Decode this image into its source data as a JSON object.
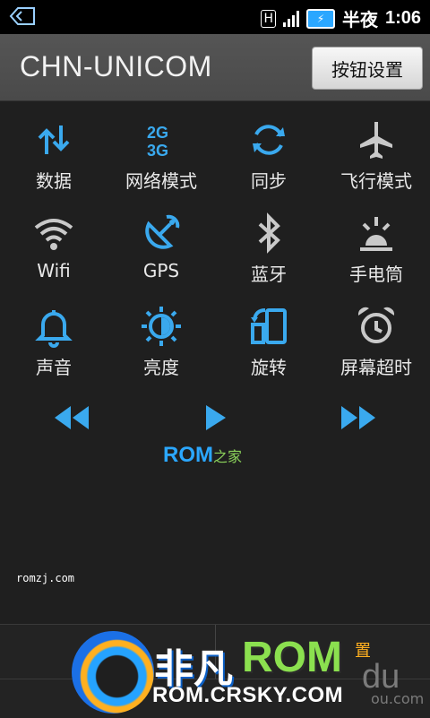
{
  "status_bar": {
    "time": "1:06",
    "period": "半夜",
    "network": "H",
    "back_icon": "back-arrow-icon",
    "battery_icon": "battery-charging-icon",
    "signal_icon": "signal-strength-icon"
  },
  "header": {
    "carrier": "CHN-UNICOM",
    "settings_button": "按钮设置"
  },
  "toggles": [
    {
      "label": "数据",
      "icon": "data-transfer-icon",
      "active": true
    },
    {
      "label": "网络模式",
      "icon": "network-2g3g-icon",
      "active": true
    },
    {
      "label": "同步",
      "icon": "sync-icon",
      "active": true
    },
    {
      "label": "飞行模式",
      "icon": "airplane-icon",
      "active": false
    },
    {
      "label": "Wifi",
      "icon": "wifi-icon",
      "active": false
    },
    {
      "label": "GPS",
      "icon": "gps-icon",
      "active": true
    },
    {
      "label": "蓝牙",
      "icon": "bluetooth-icon",
      "active": false
    },
    {
      "label": "手电筒",
      "icon": "flashlight-icon",
      "active": false
    },
    {
      "label": "声音",
      "icon": "bell-icon",
      "active": true
    },
    {
      "label": "亮度",
      "icon": "brightness-icon",
      "active": true
    },
    {
      "label": "旋转",
      "icon": "rotate-icon",
      "active": true
    },
    {
      "label": "屏幕超时",
      "icon": "alarm-clock-icon",
      "active": false
    }
  ],
  "media": {
    "prev_icon": "rewind-icon",
    "play_icon": "play-icon",
    "next_icon": "fast-forward-icon"
  },
  "rom_logo": {
    "text": "ROM",
    "zh": "之家"
  },
  "watermark": "romzj.com",
  "brand": {
    "fan": "非凡",
    "rom": "ROM",
    "zhi": "置",
    "url": "ROM.CRSKY.COM",
    "du": "du",
    "du_small": "ou.com"
  },
  "colors": {
    "accent": "#3aa9ee",
    "inactive": "#c9c9c9",
    "background": "#1f1f1f"
  }
}
